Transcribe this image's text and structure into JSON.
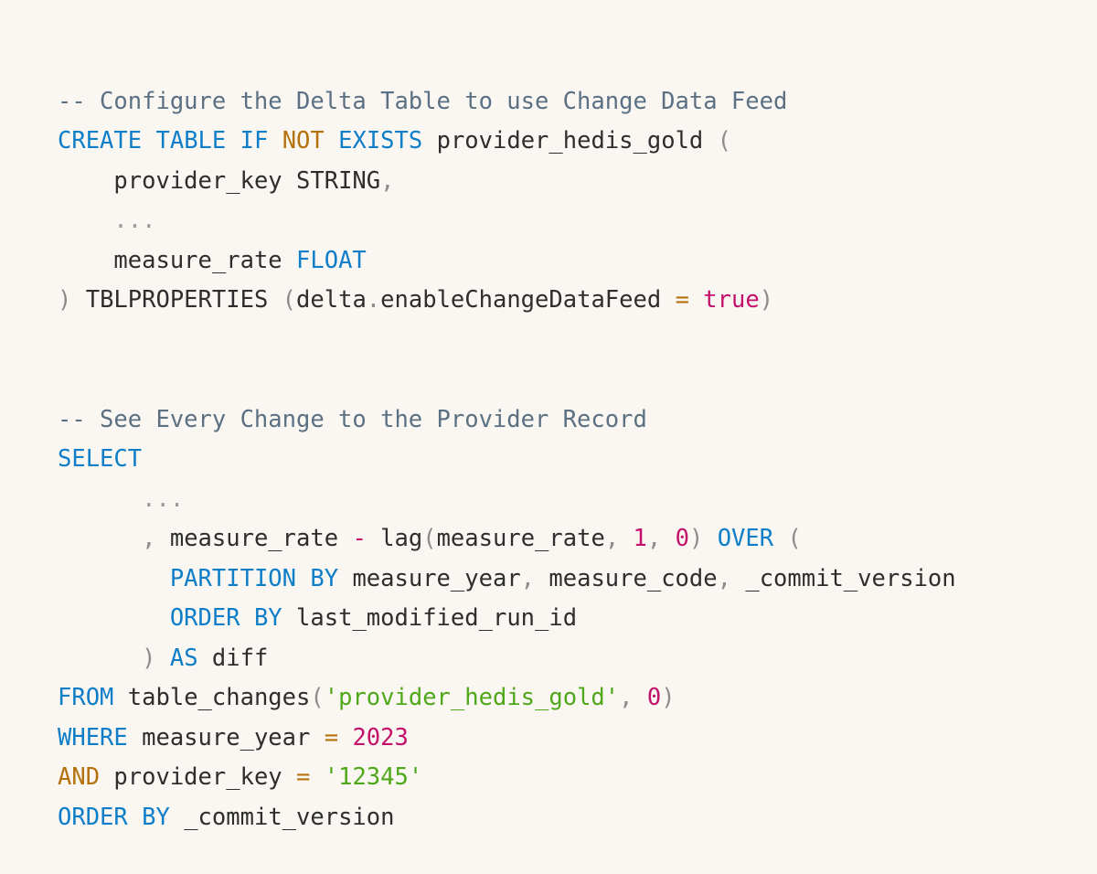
{
  "page": {
    "background_color": "#faf6f2",
    "kind": "sql-code-snippet"
  },
  "theme": {
    "comment_color": "#5b7183",
    "keyword_color": "#0f7ec8",
    "keyword_alt_color": "#b5710c",
    "string_color": "#4fa81a",
    "number_color": "#c4106a",
    "identifier_color": "#2e2e2e",
    "punctuation_color": "#8c8c8c",
    "operator_color": "#b5710c"
  },
  "code": {
    "language": "sql",
    "lines": [
      {
        "id": "line-1",
        "tokens": [
          {
            "t": "-- Configure the Delta Table to use Change Data Feed",
            "c": "tok-comment"
          }
        ]
      },
      {
        "id": "line-2",
        "tokens": [
          {
            "t": "CREATE",
            "c": "tok-keyword"
          },
          {
            "t": " ",
            "c": "tok-plain"
          },
          {
            "t": "TABLE",
            "c": "tok-keyword"
          },
          {
            "t": " ",
            "c": "tok-plain"
          },
          {
            "t": "IF",
            "c": "tok-keyword"
          },
          {
            "t": " ",
            "c": "tok-plain"
          },
          {
            "t": "NOT",
            "c": "tok-keyword2"
          },
          {
            "t": " ",
            "c": "tok-plain"
          },
          {
            "t": "EXISTS",
            "c": "tok-keyword"
          },
          {
            "t": " ",
            "c": "tok-plain"
          },
          {
            "t": "provider_hedis_gold",
            "c": "tok-ident"
          },
          {
            "t": " ",
            "c": "tok-plain"
          },
          {
            "t": "(",
            "c": "tok-punc"
          }
        ]
      },
      {
        "id": "line-3",
        "tokens": [
          {
            "t": "    ",
            "c": "tok-plain"
          },
          {
            "t": "provider_key",
            "c": "tok-ident"
          },
          {
            "t": " ",
            "c": "tok-plain"
          },
          {
            "t": "STRING",
            "c": "tok-ident"
          },
          {
            "t": ",",
            "c": "tok-punc"
          }
        ]
      },
      {
        "id": "line-4",
        "tokens": [
          {
            "t": "    ",
            "c": "tok-plain"
          },
          {
            "t": "...",
            "c": "tok-dots"
          }
        ]
      },
      {
        "id": "line-5",
        "tokens": [
          {
            "t": "    ",
            "c": "tok-plain"
          },
          {
            "t": "measure_rate",
            "c": "tok-ident"
          },
          {
            "t": " ",
            "c": "tok-plain"
          },
          {
            "t": "FLOAT",
            "c": "tok-type"
          }
        ]
      },
      {
        "id": "line-6",
        "tokens": [
          {
            "t": ")",
            "c": "tok-punc"
          },
          {
            "t": " ",
            "c": "tok-plain"
          },
          {
            "t": "TBLPROPERTIES",
            "c": "tok-ident"
          },
          {
            "t": " ",
            "c": "tok-plain"
          },
          {
            "t": "(",
            "c": "tok-punc"
          },
          {
            "t": "delta",
            "c": "tok-ident"
          },
          {
            "t": ".",
            "c": "tok-punc"
          },
          {
            "t": "enableChangeDataFeed",
            "c": "tok-ident"
          },
          {
            "t": " ",
            "c": "tok-plain"
          },
          {
            "t": "=",
            "c": "tok-op"
          },
          {
            "t": " ",
            "c": "tok-plain"
          },
          {
            "t": "true",
            "c": "tok-bool"
          },
          {
            "t": ")",
            "c": "tok-punc"
          }
        ]
      },
      {
        "id": "line-7",
        "tokens": []
      },
      {
        "id": "line-8",
        "tokens": []
      },
      {
        "id": "line-9",
        "tokens": [
          {
            "t": "-- See Every Change to the Provider Record",
            "c": "tok-comment"
          }
        ]
      },
      {
        "id": "line-10",
        "tokens": [
          {
            "t": "SELECT",
            "c": "tok-keyword"
          }
        ]
      },
      {
        "id": "line-11",
        "tokens": [
          {
            "t": "      ",
            "c": "tok-plain"
          },
          {
            "t": "...",
            "c": "tok-dots"
          }
        ]
      },
      {
        "id": "line-12",
        "tokens": [
          {
            "t": "    ",
            "c": "tok-plain"
          },
          {
            "t": "  , ",
            "c": "tok-punc"
          },
          {
            "t": "measure_rate",
            "c": "tok-ident"
          },
          {
            "t": " ",
            "c": "tok-plain"
          },
          {
            "t": "-",
            "c": "tok-op-dash"
          },
          {
            "t": " ",
            "c": "tok-plain"
          },
          {
            "t": "lag",
            "c": "tok-func"
          },
          {
            "t": "(",
            "c": "tok-punc"
          },
          {
            "t": "measure_rate",
            "c": "tok-ident"
          },
          {
            "t": ", ",
            "c": "tok-punc"
          },
          {
            "t": "1",
            "c": "tok-number"
          },
          {
            "t": ", ",
            "c": "tok-punc"
          },
          {
            "t": "0",
            "c": "tok-number"
          },
          {
            "t": ")",
            "c": "tok-punc"
          },
          {
            "t": " ",
            "c": "tok-plain"
          },
          {
            "t": "OVER",
            "c": "tok-keyword"
          },
          {
            "t": " ",
            "c": "tok-plain"
          },
          {
            "t": "(",
            "c": "tok-punc"
          }
        ]
      },
      {
        "id": "line-13",
        "tokens": [
          {
            "t": "        ",
            "c": "tok-plain"
          },
          {
            "t": "PARTITION",
            "c": "tok-keyword"
          },
          {
            "t": " ",
            "c": "tok-plain"
          },
          {
            "t": "BY",
            "c": "tok-keyword"
          },
          {
            "t": " ",
            "c": "tok-plain"
          },
          {
            "t": "measure_year",
            "c": "tok-ident"
          },
          {
            "t": ", ",
            "c": "tok-punc"
          },
          {
            "t": "measure_code",
            "c": "tok-ident"
          },
          {
            "t": ", ",
            "c": "tok-punc"
          },
          {
            "t": "_commit_version",
            "c": "tok-ident"
          }
        ]
      },
      {
        "id": "line-14",
        "tokens": [
          {
            "t": "        ",
            "c": "tok-plain"
          },
          {
            "t": "ORDER",
            "c": "tok-keyword"
          },
          {
            "t": " ",
            "c": "tok-plain"
          },
          {
            "t": "BY",
            "c": "tok-keyword"
          },
          {
            "t": " ",
            "c": "tok-plain"
          },
          {
            "t": "last_modified_run_id",
            "c": "tok-ident"
          }
        ]
      },
      {
        "id": "line-15",
        "tokens": [
          {
            "t": "      ",
            "c": "tok-plain"
          },
          {
            "t": ")",
            "c": "tok-punc"
          },
          {
            "t": " ",
            "c": "tok-plain"
          },
          {
            "t": "AS",
            "c": "tok-keyword"
          },
          {
            "t": " ",
            "c": "tok-plain"
          },
          {
            "t": "diff",
            "c": "tok-ident"
          }
        ]
      },
      {
        "id": "line-16",
        "tokens": [
          {
            "t": "FROM",
            "c": "tok-keyword"
          },
          {
            "t": " ",
            "c": "tok-plain"
          },
          {
            "t": "table_changes",
            "c": "tok-func"
          },
          {
            "t": "(",
            "c": "tok-punc"
          },
          {
            "t": "'provider_hedis_gold'",
            "c": "tok-string"
          },
          {
            "t": ", ",
            "c": "tok-punc"
          },
          {
            "t": "0",
            "c": "tok-number"
          },
          {
            "t": ")",
            "c": "tok-punc"
          }
        ]
      },
      {
        "id": "line-17",
        "tokens": [
          {
            "t": "WHERE",
            "c": "tok-keyword"
          },
          {
            "t": " ",
            "c": "tok-plain"
          },
          {
            "t": "measure_year",
            "c": "tok-ident"
          },
          {
            "t": " ",
            "c": "tok-plain"
          },
          {
            "t": "=",
            "c": "tok-op"
          },
          {
            "t": " ",
            "c": "tok-plain"
          },
          {
            "t": "2023",
            "c": "tok-number"
          }
        ]
      },
      {
        "id": "line-18",
        "tokens": [
          {
            "t": "AND",
            "c": "tok-keyword2"
          },
          {
            "t": " ",
            "c": "tok-plain"
          },
          {
            "t": "provider_key",
            "c": "tok-ident"
          },
          {
            "t": " ",
            "c": "tok-plain"
          },
          {
            "t": "=",
            "c": "tok-op"
          },
          {
            "t": " ",
            "c": "tok-plain"
          },
          {
            "t": "'12345'",
            "c": "tok-string"
          }
        ]
      },
      {
        "id": "line-19",
        "tokens": [
          {
            "t": "ORDER",
            "c": "tok-keyword"
          },
          {
            "t": " ",
            "c": "tok-plain"
          },
          {
            "t": "BY",
            "c": "tok-keyword"
          },
          {
            "t": " ",
            "c": "tok-plain"
          },
          {
            "t": "_commit_version",
            "c": "tok-ident"
          }
        ]
      }
    ]
  }
}
